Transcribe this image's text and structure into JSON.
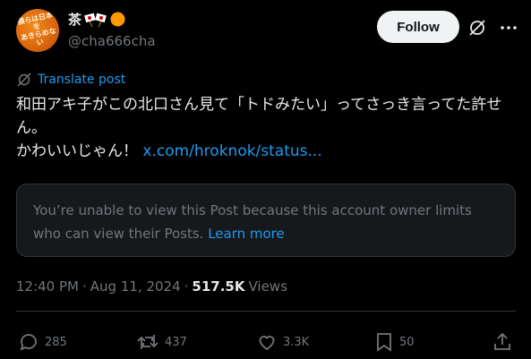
{
  "author": {
    "name": "茶",
    "handle": "@cha666cha",
    "avatar_text": "僕らは日本を\nあきらめない",
    "name_emoji": [
      "japan-flag-crossed-icon",
      "orange-circle-icon"
    ]
  },
  "header": {
    "follow_label": "Follow"
  },
  "translate_label": "Translate post",
  "post": {
    "text": "和田アキ子がこの北口さん見て「トドみたい」ってさっき言ってた許せん。\nかわいいじゃん！ ",
    "link": "x.com/hroknok/status..."
  },
  "notice": {
    "text": "You’re unable to view this Post because this account owner limits who can view their Posts. ",
    "link": "Learn more"
  },
  "meta": {
    "time": "12:40 PM",
    "sep1": "·",
    "date": "Aug 11, 2024",
    "sep2": "·",
    "views_count": "517.5K",
    "views_label": "Views"
  },
  "actions": {
    "replies": "285",
    "reposts": "437",
    "likes": "3.3K",
    "bookmarks": "50"
  },
  "colors": {
    "accent": "#1d9bf0",
    "muted": "#71767b",
    "text": "#e7e9ea",
    "bg": "#000000"
  }
}
